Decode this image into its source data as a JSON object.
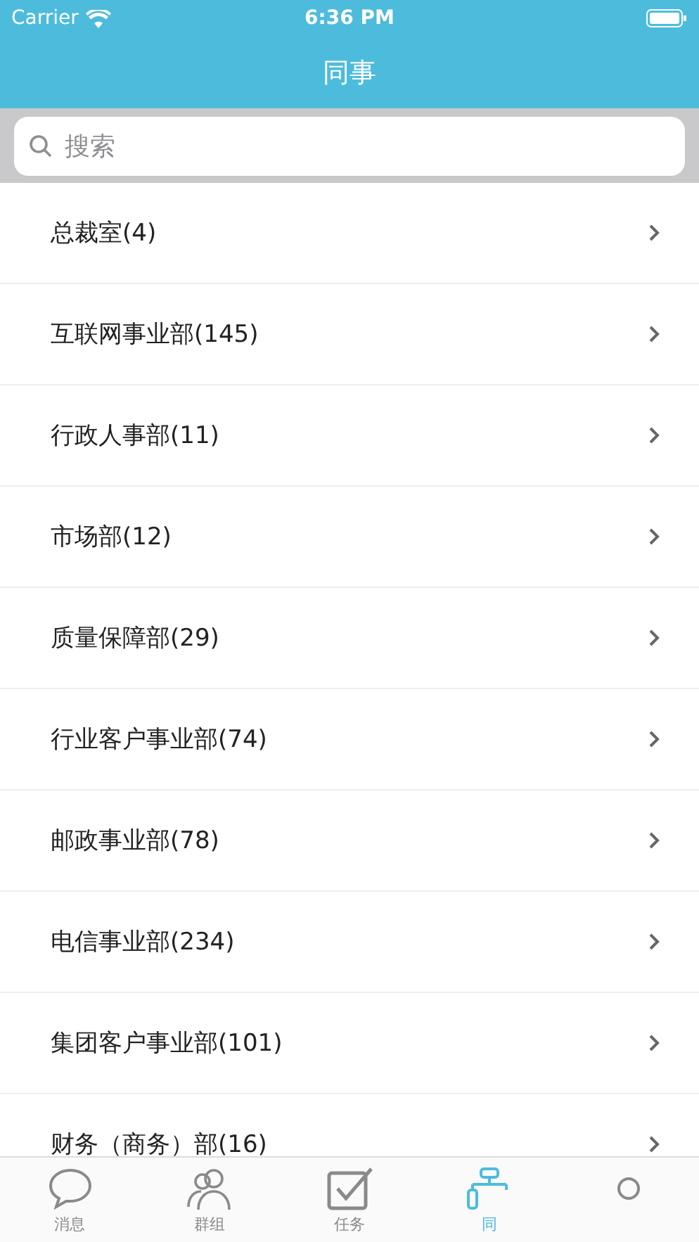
{
  "status_bar": {
    "carrier": "Carrier",
    "time": "6:36 PM"
  },
  "nav": {
    "title": "同事"
  },
  "search": {
    "placeholder": "搜索"
  },
  "departments": [
    {
      "label": "总裁室(4)"
    },
    {
      "label": "互联网事业部(145)"
    },
    {
      "label": "行政人事部(11)"
    },
    {
      "label": "市场部(12)"
    },
    {
      "label": "质量保障部(29)"
    },
    {
      "label": "行业客户事业部(74)"
    },
    {
      "label": "邮政事业部(78)"
    },
    {
      "label": "电信事业部(234)"
    },
    {
      "label": "集团客户事业部(101)"
    },
    {
      "label": "财务（商务）部(16)"
    }
  ],
  "tab_bar": [
    {
      "label": "消息",
      "selected": false
    },
    {
      "label": "群组",
      "selected": false
    },
    {
      "label": "任务",
      "selected": false
    },
    {
      "label": "同",
      "selected": true
    },
    {
      "selected": false
    }
  ]
}
